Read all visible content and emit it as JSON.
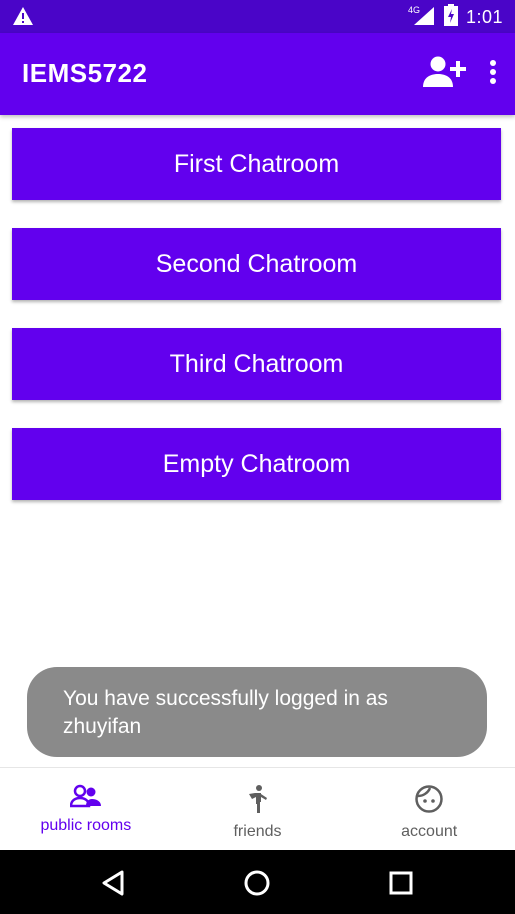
{
  "status_bar": {
    "time": "1:01",
    "network": "4G",
    "icons": [
      "warning-icon",
      "signal-icon",
      "battery-icon"
    ]
  },
  "app_bar": {
    "title": "IEMS5722",
    "actions": [
      "add-person-icon",
      "more-vert-icon"
    ]
  },
  "rooms": [
    {
      "label": "First Chatroom"
    },
    {
      "label": "Second Chatroom"
    },
    {
      "label": "Third Chatroom"
    },
    {
      "label": "Empty Chatroom"
    }
  ],
  "toast": {
    "message": "You have successfully logged in as zhuyifan"
  },
  "bottom_nav": {
    "items": [
      {
        "label": "public rooms",
        "icon": "people-icon",
        "active": true
      },
      {
        "label": "friends",
        "icon": "person-walking-icon",
        "active": false
      },
      {
        "label": "account",
        "icon": "face-icon",
        "active": false
      }
    ]
  },
  "system_nav": {
    "buttons": [
      "back-icon",
      "home-icon",
      "recents-icon"
    ]
  },
  "colors": {
    "primary": "#6200ee",
    "status_bar": "#4a05c8",
    "toast_bg": "#8a8a8a"
  }
}
